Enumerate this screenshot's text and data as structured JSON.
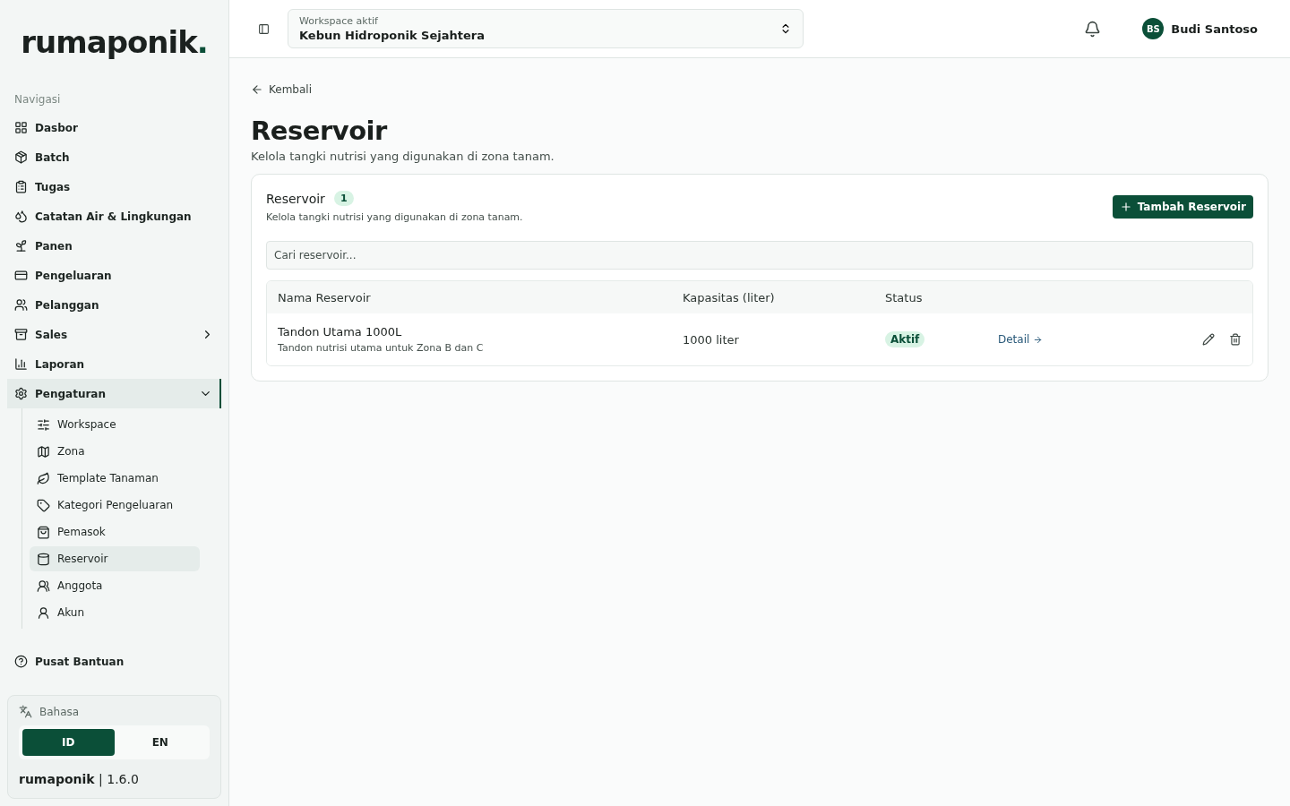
{
  "sidebar": {
    "logo": {
      "text": "rumaponik",
      "dot": "."
    },
    "section_label": "Navigasi",
    "items": [
      {
        "label": "Dasbor",
        "selected": false
      },
      {
        "label": "Batch",
        "selected": false
      },
      {
        "label": "Tugas",
        "selected": false
      },
      {
        "label": "Catatan Air & Lingkungan",
        "selected": false
      },
      {
        "label": "Panen",
        "selected": false
      },
      {
        "label": "Pengeluaran",
        "selected": false
      },
      {
        "label": "Pelanggan",
        "selected": false
      },
      {
        "label": "Sales",
        "selected": false,
        "expanded": false
      },
      {
        "label": "Laporan",
        "selected": false
      },
      {
        "label": "Pengaturan",
        "selected": true,
        "expanded": true,
        "children": [
          {
            "label": "Workspace",
            "selected": false
          },
          {
            "label": "Zona",
            "selected": false
          },
          {
            "label": "Template Tanaman",
            "selected": false
          },
          {
            "label": "Kategori Pengeluaran",
            "selected": false
          },
          {
            "label": "Pemasok",
            "selected": false
          },
          {
            "label": "Reservoir",
            "selected": true
          },
          {
            "label": "Anggota",
            "selected": false
          },
          {
            "label": "Akun",
            "selected": false
          }
        ]
      }
    ],
    "help": "Pusat Bantuan",
    "language": {
      "label": "Bahasa",
      "options": [
        {
          "label": "ID",
          "selected": true
        },
        {
          "label": "EN",
          "selected": false
        }
      ]
    },
    "footer": {
      "brand": "rumaponik",
      "separator": "|",
      "version": "1.6.0"
    }
  },
  "header": {
    "workspace": {
      "label": "Workspace aktif",
      "value": "Kebun Hidroponik Sejahtera"
    },
    "user": {
      "initials": "BS",
      "name": "Budi Santoso"
    }
  },
  "page": {
    "back": "Kembali",
    "title": "Reservoir",
    "subtitle": "Kelola tangki nutrisi yang digunakan di zona tanam.",
    "card": {
      "title": "Reservoir",
      "count": "1",
      "description": "Kelola tangki nutrisi yang digunakan di zona tanam.",
      "add_button": "Tambah Reservoir",
      "search": {
        "placeholder": "Cari reservoir..."
      },
      "table": {
        "columns": [
          "Nama Reservoir",
          "Kapasitas (liter)",
          "Status"
        ],
        "rows": [
          {
            "name": "Tandon Utama 1000L",
            "description": "Tandon nutrisi utama untuk Zona B dan C",
            "capacity": "1000 liter",
            "status": "Aktif",
            "detail": "Detail"
          }
        ]
      }
    }
  }
}
